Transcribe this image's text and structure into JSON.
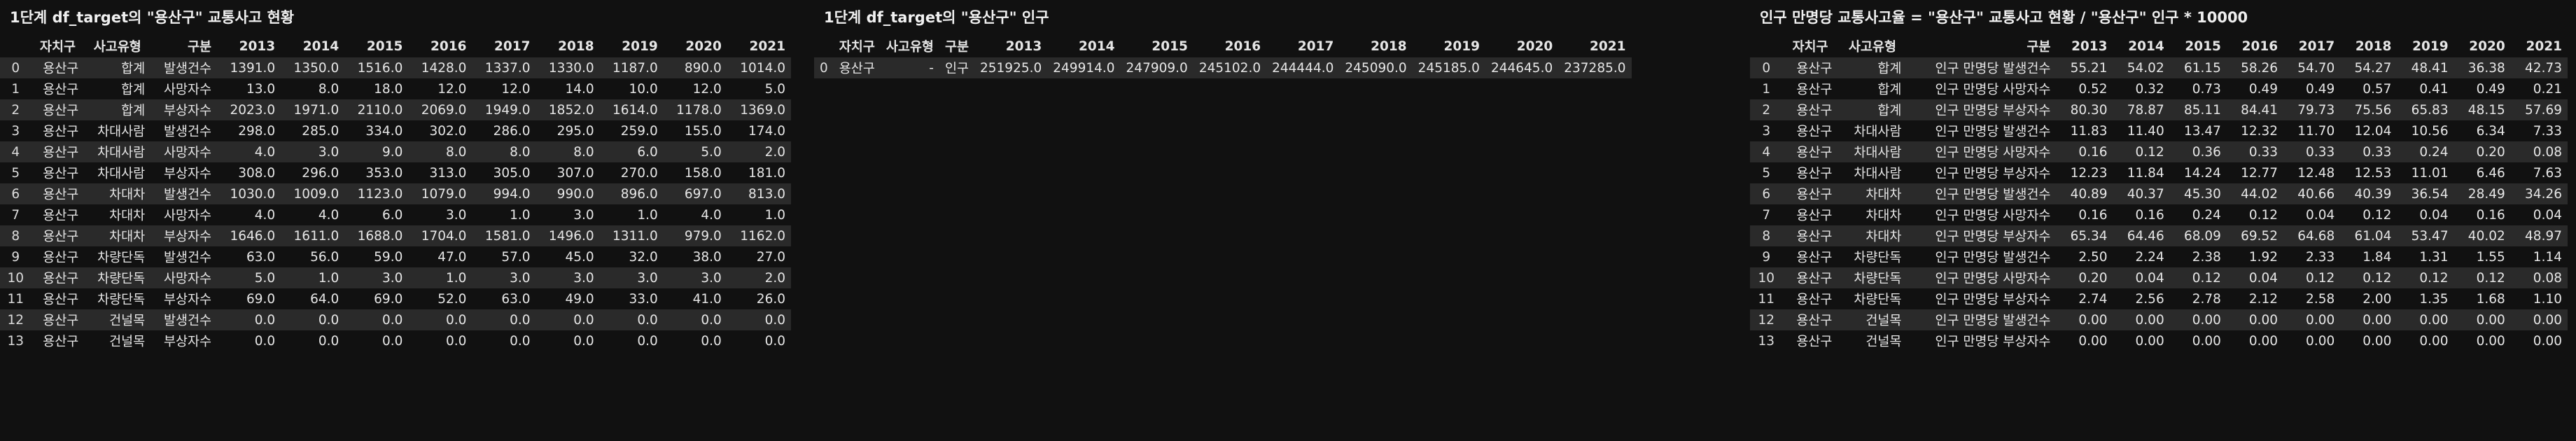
{
  "panel1": {
    "title": "1단계 df_target의 \"용산구\" 교통사고 현황",
    "headers": [
      "",
      "자치구",
      "사고유형",
      "구분",
      "2013",
      "2014",
      "2015",
      "2016",
      "2017",
      "2018",
      "2019",
      "2020",
      "2021"
    ],
    "rows": [
      [
        "0",
        "용산구",
        "합계",
        "발생건수",
        "1391.0",
        "1350.0",
        "1516.0",
        "1428.0",
        "1337.0",
        "1330.0",
        "1187.0",
        "890.0",
        "1014.0"
      ],
      [
        "1",
        "용산구",
        "합계",
        "사망자수",
        "13.0",
        "8.0",
        "18.0",
        "12.0",
        "12.0",
        "14.0",
        "10.0",
        "12.0",
        "5.0"
      ],
      [
        "2",
        "용산구",
        "합계",
        "부상자수",
        "2023.0",
        "1971.0",
        "2110.0",
        "2069.0",
        "1949.0",
        "1852.0",
        "1614.0",
        "1178.0",
        "1369.0"
      ],
      [
        "3",
        "용산구",
        "차대사람",
        "발생건수",
        "298.0",
        "285.0",
        "334.0",
        "302.0",
        "286.0",
        "295.0",
        "259.0",
        "155.0",
        "174.0"
      ],
      [
        "4",
        "용산구",
        "차대사람",
        "사망자수",
        "4.0",
        "3.0",
        "9.0",
        "8.0",
        "8.0",
        "8.0",
        "6.0",
        "5.0",
        "2.0"
      ],
      [
        "5",
        "용산구",
        "차대사람",
        "부상자수",
        "308.0",
        "296.0",
        "353.0",
        "313.0",
        "305.0",
        "307.0",
        "270.0",
        "158.0",
        "181.0"
      ],
      [
        "6",
        "용산구",
        "차대차",
        "발생건수",
        "1030.0",
        "1009.0",
        "1123.0",
        "1079.0",
        "994.0",
        "990.0",
        "896.0",
        "697.0",
        "813.0"
      ],
      [
        "7",
        "용산구",
        "차대차",
        "사망자수",
        "4.0",
        "4.0",
        "6.0",
        "3.0",
        "1.0",
        "3.0",
        "1.0",
        "4.0",
        "1.0"
      ],
      [
        "8",
        "용산구",
        "차대차",
        "부상자수",
        "1646.0",
        "1611.0",
        "1688.0",
        "1704.0",
        "1581.0",
        "1496.0",
        "1311.0",
        "979.0",
        "1162.0"
      ],
      [
        "9",
        "용산구",
        "차량단독",
        "발생건수",
        "63.0",
        "56.0",
        "59.0",
        "47.0",
        "57.0",
        "45.0",
        "32.0",
        "38.0",
        "27.0"
      ],
      [
        "10",
        "용산구",
        "차량단독",
        "사망자수",
        "5.0",
        "1.0",
        "3.0",
        "1.0",
        "3.0",
        "3.0",
        "3.0",
        "3.0",
        "2.0"
      ],
      [
        "11",
        "용산구",
        "차량단독",
        "부상자수",
        "69.0",
        "64.0",
        "69.0",
        "52.0",
        "63.0",
        "49.0",
        "33.0",
        "41.0",
        "26.0"
      ],
      [
        "12",
        "용산구",
        "건널목",
        "발생건수",
        "0.0",
        "0.0",
        "0.0",
        "0.0",
        "0.0",
        "0.0",
        "0.0",
        "0.0",
        "0.0"
      ],
      [
        "13",
        "용산구",
        "건널목",
        "부상자수",
        "0.0",
        "0.0",
        "0.0",
        "0.0",
        "0.0",
        "0.0",
        "0.0",
        "0.0",
        "0.0"
      ]
    ]
  },
  "panel2": {
    "title": "1단계 df_target의 \"용산구\" 인구",
    "headers": [
      "",
      "자치구",
      "사고유형",
      "구분",
      "2013",
      "2014",
      "2015",
      "2016",
      "2017",
      "2018",
      "2019",
      "2020",
      "2021"
    ],
    "rows": [
      [
        "0",
        "용산구",
        "-",
        "인구",
        "251925.0",
        "249914.0",
        "247909.0",
        "245102.0",
        "244444.0",
        "245090.0",
        "245185.0",
        "244645.0",
        "237285.0"
      ]
    ]
  },
  "panel3": {
    "title": "인구 만명당 교통사고율 = \"용산구\" 교통사고 현황 / \"용산구\" 인구 * 10000",
    "headers": [
      "",
      "자치구",
      "사고유형",
      "구분",
      "2013",
      "2014",
      "2015",
      "2016",
      "2017",
      "2018",
      "2019",
      "2020",
      "2021"
    ],
    "rows": [
      [
        "0",
        "용산구",
        "합계",
        "인구 만명당 발생건수",
        "55.21",
        "54.02",
        "61.15",
        "58.26",
        "54.70",
        "54.27",
        "48.41",
        "36.38",
        "42.73"
      ],
      [
        "1",
        "용산구",
        "합계",
        "인구 만명당 사망자수",
        "0.52",
        "0.32",
        "0.73",
        "0.49",
        "0.49",
        "0.57",
        "0.41",
        "0.49",
        "0.21"
      ],
      [
        "2",
        "용산구",
        "합계",
        "인구 만명당 부상자수",
        "80.30",
        "78.87",
        "85.11",
        "84.41",
        "79.73",
        "75.56",
        "65.83",
        "48.15",
        "57.69"
      ],
      [
        "3",
        "용산구",
        "차대사람",
        "인구 만명당 발생건수",
        "11.83",
        "11.40",
        "13.47",
        "12.32",
        "11.70",
        "12.04",
        "10.56",
        "6.34",
        "7.33"
      ],
      [
        "4",
        "용산구",
        "차대사람",
        "인구 만명당 사망자수",
        "0.16",
        "0.12",
        "0.36",
        "0.33",
        "0.33",
        "0.33",
        "0.24",
        "0.20",
        "0.08"
      ],
      [
        "5",
        "용산구",
        "차대사람",
        "인구 만명당 부상자수",
        "12.23",
        "11.84",
        "14.24",
        "12.77",
        "12.48",
        "12.53",
        "11.01",
        "6.46",
        "7.63"
      ],
      [
        "6",
        "용산구",
        "차대차",
        "인구 만명당 발생건수",
        "40.89",
        "40.37",
        "45.30",
        "44.02",
        "40.66",
        "40.39",
        "36.54",
        "28.49",
        "34.26"
      ],
      [
        "7",
        "용산구",
        "차대차",
        "인구 만명당 사망자수",
        "0.16",
        "0.16",
        "0.24",
        "0.12",
        "0.04",
        "0.12",
        "0.04",
        "0.16",
        "0.04"
      ],
      [
        "8",
        "용산구",
        "차대차",
        "인구 만명당 부상자수",
        "65.34",
        "64.46",
        "68.09",
        "69.52",
        "64.68",
        "61.04",
        "53.47",
        "40.02",
        "48.97"
      ],
      [
        "9",
        "용산구",
        "차량단독",
        "인구 만명당 발생건수",
        "2.50",
        "2.24",
        "2.38",
        "1.92",
        "2.33",
        "1.84",
        "1.31",
        "1.55",
        "1.14"
      ],
      [
        "10",
        "용산구",
        "차량단독",
        "인구 만명당 사망자수",
        "0.20",
        "0.04",
        "0.12",
        "0.04",
        "0.12",
        "0.12",
        "0.12",
        "0.12",
        "0.08"
      ],
      [
        "11",
        "용산구",
        "차량단독",
        "인구 만명당 부상자수",
        "2.74",
        "2.56",
        "2.78",
        "2.12",
        "2.58",
        "2.00",
        "1.35",
        "1.68",
        "1.10"
      ],
      [
        "12",
        "용산구",
        "건널목",
        "인구 만명당 발생건수",
        "0.00",
        "0.00",
        "0.00",
        "0.00",
        "0.00",
        "0.00",
        "0.00",
        "0.00",
        "0.00"
      ],
      [
        "13",
        "용산구",
        "건널목",
        "인구 만명당 부상자수",
        "0.00",
        "0.00",
        "0.00",
        "0.00",
        "0.00",
        "0.00",
        "0.00",
        "0.00",
        "0.00"
      ]
    ]
  }
}
